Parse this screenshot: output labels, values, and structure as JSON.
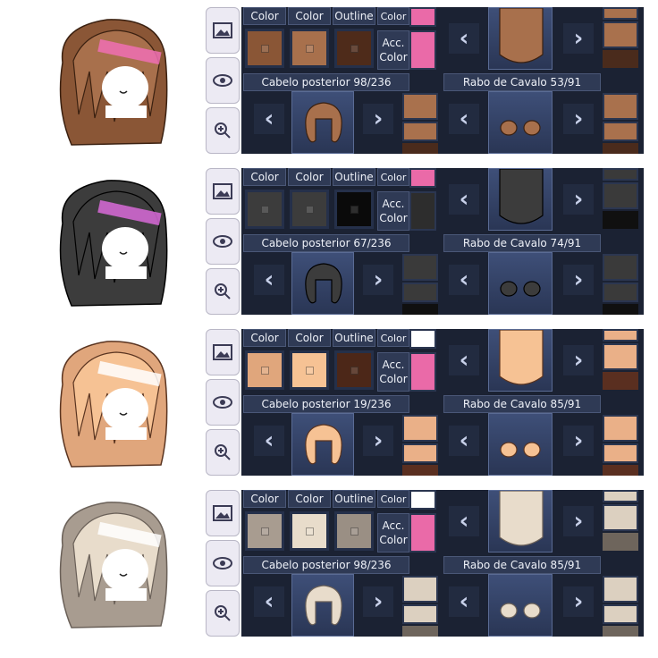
{
  "labels": {
    "color1": "Color",
    "color2": "Color",
    "outline": "Outline",
    "color_top": "Color",
    "acc_line1": "Acc.",
    "acc_line2": "Color"
  },
  "rows": [
    {
      "back_hair_title": "Cabelo posterior 98/236",
      "ponytail_title": "Rabo de Cavalo 53/91",
      "colors": {
        "color1": "#8a5636",
        "color2": "#a8704c",
        "outline": "#4e2b1a",
        "acc": "#ea6aa8",
        "top": "#ea6aa8",
        "mini": "#a9714d",
        "dark": "#4a2b1c"
      }
    },
    {
      "back_hair_title": "Cabelo posterior 67/236",
      "ponytail_title": "Rabo de Cavalo 74/91",
      "colors": {
        "color1": "#3c3c3c",
        "color2": "#3c3c3c",
        "outline": "#0a0a0a",
        "acc": "#2d2d2d",
        "top": "#ea6aa8",
        "mini": "#3a3a3a",
        "dark": "#101010"
      }
    },
    {
      "back_hair_title": "Cabelo posterior 19/236",
      "ponytail_title": "Rabo de Cavalo 85/91",
      "colors": {
        "color1": "#e0a67c",
        "color2": "#f6c294",
        "outline": "#4c2718",
        "acc": "#ea6aa8",
        "top": "#ffffff",
        "mini": "#eab088",
        "dark": "#5a2f20"
      }
    },
    {
      "back_hair_title": "Cabelo posterior 98/236",
      "ponytail_title": "Rabo de Cavalo 85/91",
      "colors": {
        "color1": "#a89c90",
        "color2": "#e8dccb",
        "outline": "#9a8f84",
        "acc": "#ea6aa8",
        "top": "#ffffff",
        "mini": "#dcd0c0",
        "dark": "#6e655c"
      }
    }
  ]
}
